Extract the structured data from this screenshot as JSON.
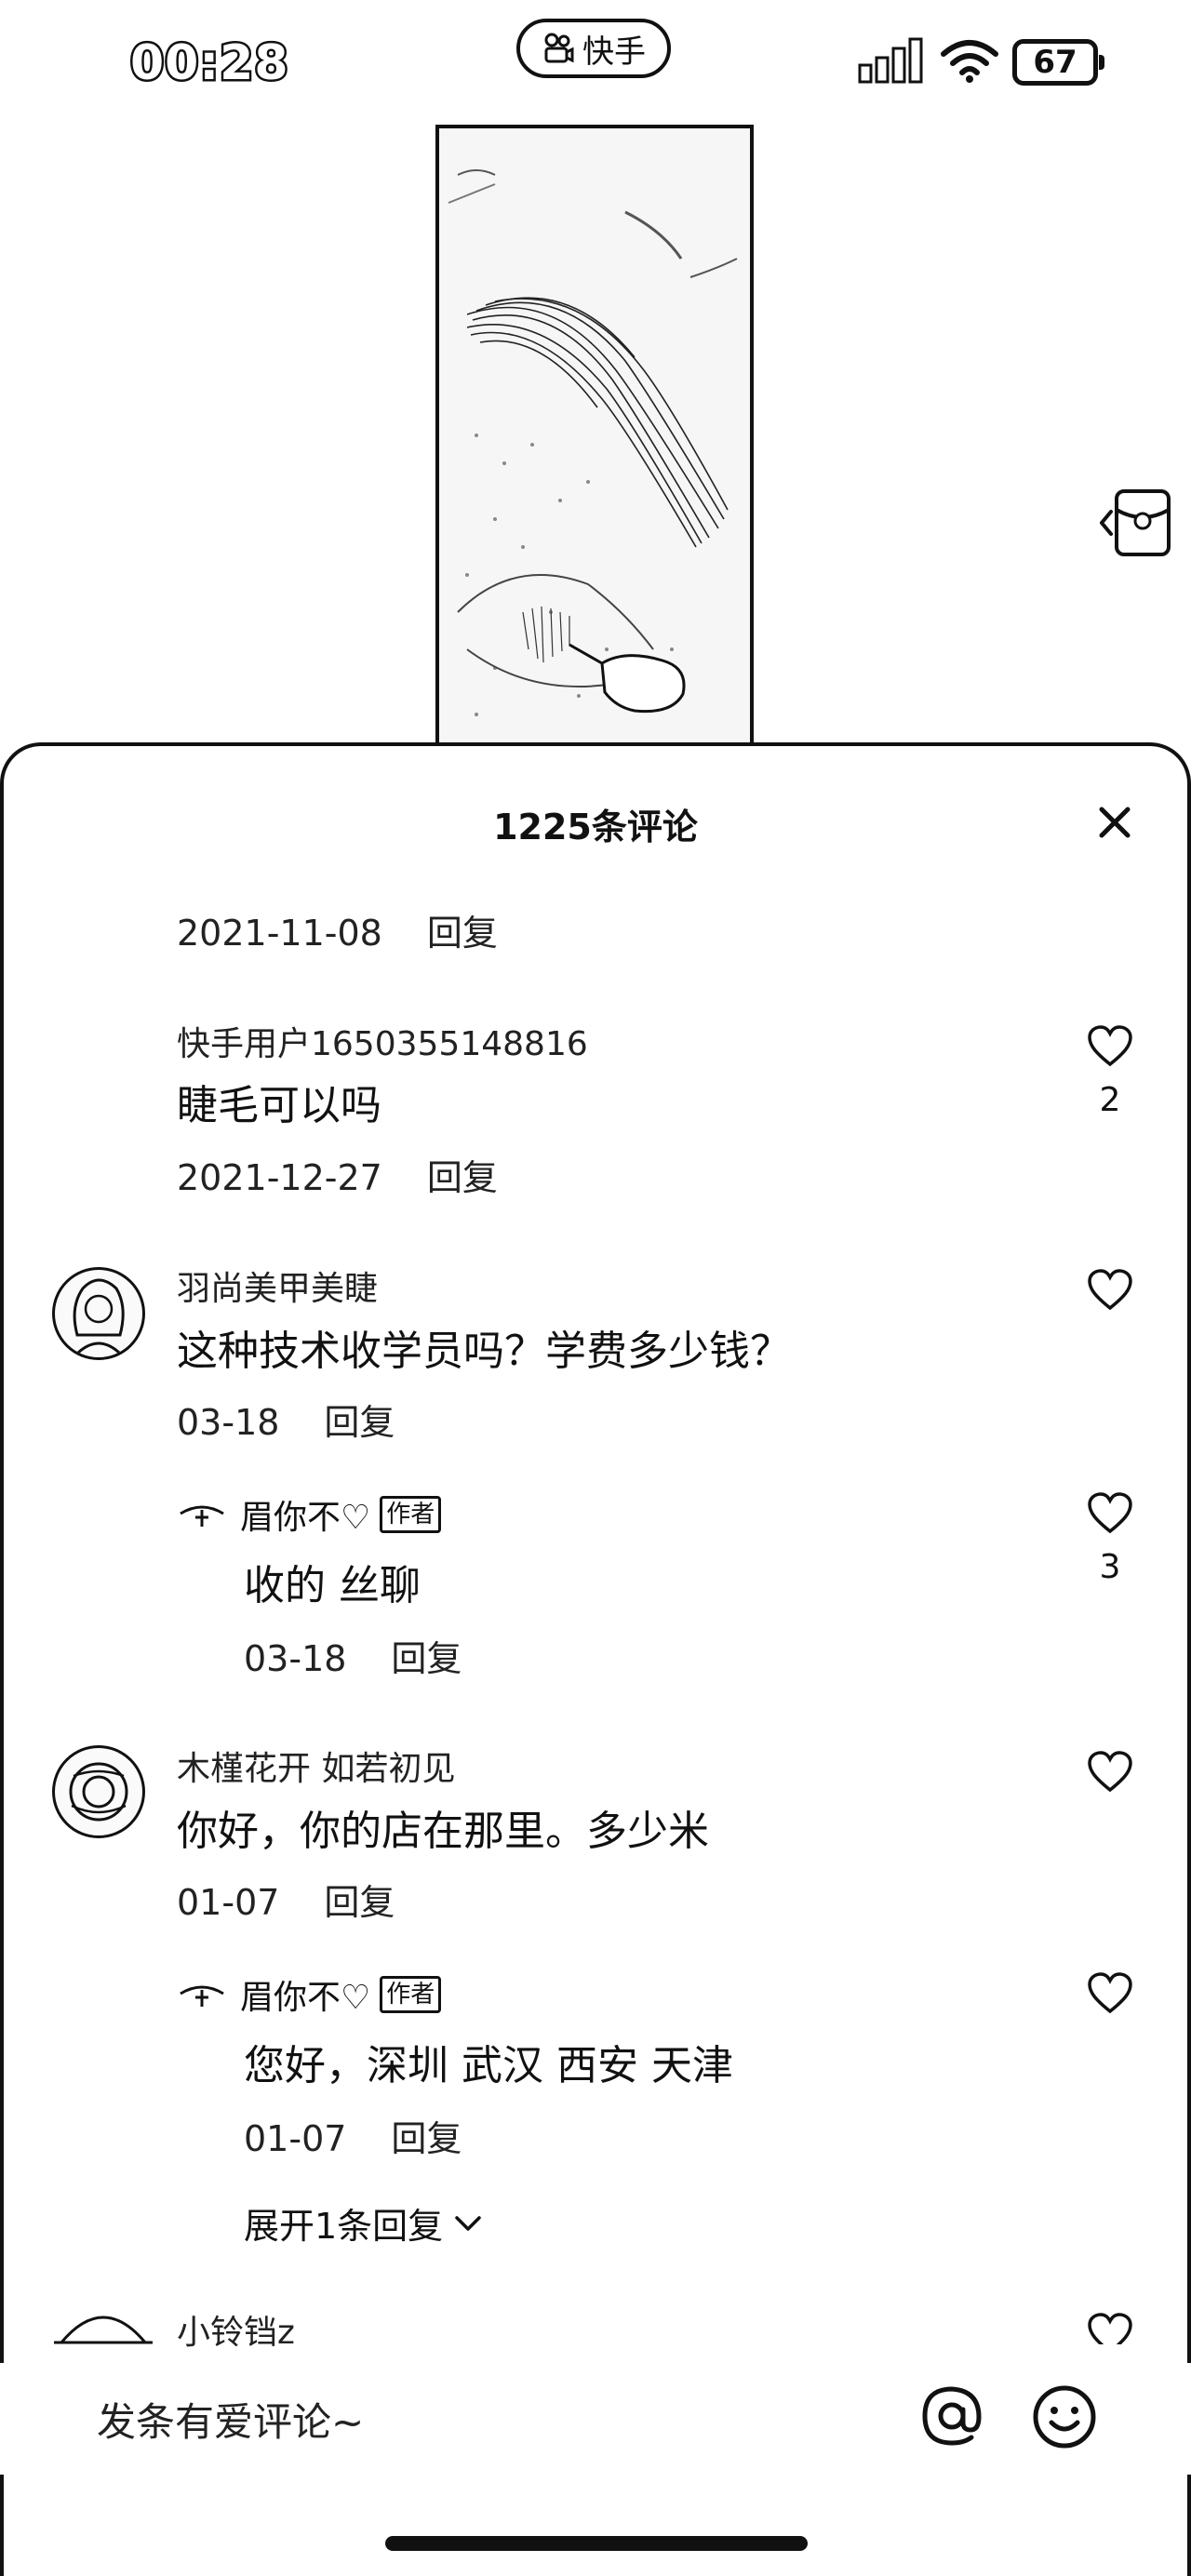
{
  "status_bar": {
    "time": "00:28",
    "app_name": "快手",
    "battery": "67"
  },
  "sheet": {
    "title": "1225条评论"
  },
  "comments": [
    {
      "date": "2021-11-08",
      "reply_label": "回复"
    },
    {
      "username": "快手用户1650355148816",
      "text": "睫毛可以吗",
      "date": "2021-12-27",
      "reply_label": "回复",
      "likes": "2"
    },
    {
      "username": "羽尚美甲美睫",
      "text": "这种技术收学员吗？学费多少钱？",
      "date": "03-18",
      "reply_label": "回复",
      "reply": {
        "username": "眉你不♡",
        "author_tag": "作者",
        "text": "收的 丝聊",
        "date": "03-18",
        "reply_label": "回复",
        "likes": "3"
      }
    },
    {
      "username": "木槿花开  如若初见",
      "text": "你好，你的店在那里。多少米",
      "date": "01-07",
      "reply_label": "回复",
      "reply": {
        "username": "眉你不♡",
        "author_tag": "作者",
        "text": "您好，深圳 武汉 西安 天津",
        "date": "01-07",
        "reply_label": "回复"
      },
      "expand_label": "展开1条回复"
    },
    {
      "username": "小铃铛z"
    }
  ],
  "input": {
    "placeholder": "发条有爱评论~"
  },
  "colors": {
    "ink": "#111111",
    "background": "#ffffff"
  }
}
